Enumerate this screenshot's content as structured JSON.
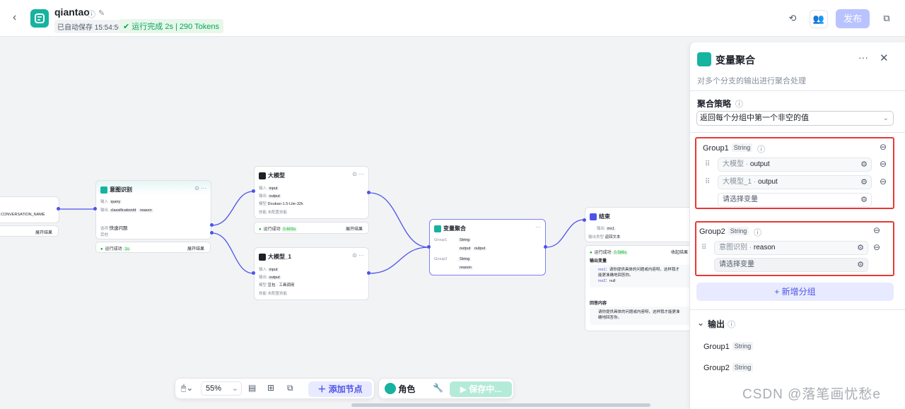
{
  "header": {
    "back_icon": "chevron-left-icon",
    "app_name": "qiantao",
    "autosave": "已自动保存 15:54:56",
    "run_status": "运行完成 2s | 290 Tokens",
    "publish_label": "发布",
    "colors": {
      "brand": "#16b3a0",
      "accent": "#4d53e8",
      "success": "#00a65b"
    }
  },
  "canvas": {
    "start_node": {
      "var": "CONVERSATION_NAME",
      "expand": "展开结果"
    },
    "intent_node": {
      "title": "意图识别",
      "input_label": "输入",
      "input_var": "query",
      "output_label": "输出",
      "output_var1": "classificationId",
      "output_var2": "reason",
      "option_label": "选项",
      "option_value": "快速问题",
      "other_label": "其他",
      "status": "运行成功",
      "status_time": "1s",
      "expand": "展开结果"
    },
    "llm1": {
      "title": "大模型",
      "input_label": "输入",
      "input_var": "input",
      "output_label": "输出",
      "output_var": "output",
      "model_label": "模型",
      "model_value": "Doubao-1.5-Lite-32k",
      "skill_label": "技能",
      "skill_value": "未配置技能",
      "status": "运行成功",
      "status_time": "0.603s",
      "expand": "展开结果"
    },
    "llm2": {
      "title": "大模型_1",
      "input_label": "输入",
      "input_var": "input",
      "output_label": "输出",
      "output_var": "output",
      "model_label": "模型",
      "model_value": "豆包 · 工具调用",
      "skill_label": "技能",
      "skill_value": "未配置技能"
    },
    "aggregate": {
      "title": "变量聚合",
      "group1": "Group1",
      "group1_type": "String",
      "group1_vars": [
        "output",
        "output"
      ],
      "group2": "Group2",
      "group2_type": "String",
      "group2_var": "reason"
    },
    "end_node": {
      "title": "结束",
      "output_label": "输出",
      "output_var": "mx1",
      "output_type_label": "输出类型",
      "output_type": "返回文本",
      "status": "运行成功",
      "status_time": "0.586s",
      "collapse": "收起结果",
      "output_vars_title": "输出变量",
      "mx1_key": "mx1",
      "mx1_value": "请你提供具体的问题或内容呀，这样我才能更准确地回答你。",
      "mx2_key": "mx2",
      "mx2_value": "null",
      "answer_title": "回答内容",
      "answer_text": "请你提供具体的问题或内容呀，这样我才能更准确地回答你。"
    }
  },
  "toolbar": {
    "zoom": "55%",
    "add_node": "添加节点",
    "role": "角色",
    "saving": "保存中..."
  },
  "panel": {
    "title": "变量聚合",
    "description": "对多个分支的输出进行聚合处理",
    "strategy_label": "聚合策略",
    "strategy_value": "返回每个分组中第一个非空的值",
    "group1": {
      "name": "Group1",
      "type": "String",
      "vars": [
        {
          "prefix": "大模型 · ",
          "name": "output"
        },
        {
          "prefix": "大模型_1 · ",
          "name": "output"
        }
      ],
      "placeholder": "请选择变量"
    },
    "group2": {
      "name": "Group2",
      "type": "String",
      "vars": [
        {
          "prefix": "意图识别 · ",
          "name": "reason"
        }
      ],
      "placeholder": "请选择变量"
    },
    "add_group": "+ 新增分组",
    "output_label": "输出",
    "outputs": [
      {
        "name": "Group1",
        "type": "String"
      },
      {
        "name": "Group2",
        "type": "String"
      }
    ]
  },
  "watermark": "CSDN @落笔画忧愁e"
}
